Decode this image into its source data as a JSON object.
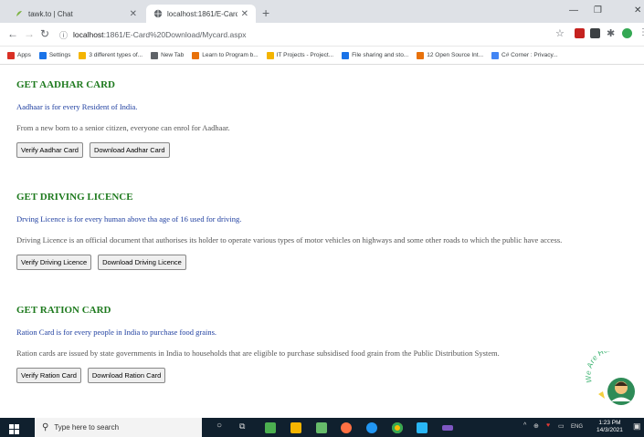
{
  "browser": {
    "tabs": [
      {
        "title": "tawk.to | Chat",
        "active": false
      },
      {
        "title": "localhost:1861/E-Card Downloa",
        "active": true
      }
    ],
    "address": {
      "host": "localhost",
      "path": ":1861/E-Card%20Download/Mycard.aspx"
    },
    "bookmarks": [
      {
        "label": "Apps",
        "icon": "apps-grid-icon",
        "color": "#d93025"
      },
      {
        "label": "Settings",
        "icon": "gear-icon",
        "color": "#1a73e8"
      },
      {
        "label": "3 different types of...",
        "icon": "bookmark-icon",
        "color": "#f4b400"
      },
      {
        "label": "New Tab",
        "icon": "globe-icon",
        "color": "#5f6368"
      },
      {
        "label": "Learn to Program b...",
        "icon": "code-icon",
        "color": "#e8710a"
      },
      {
        "label": "IT Projects - Project...",
        "icon": "bookmark-icon",
        "color": "#f4b400"
      },
      {
        "label": "File sharing and sto...",
        "icon": "file-icon",
        "color": "#1a73e8"
      },
      {
        "label": "12 Open Source Int...",
        "icon": "diamond-icon",
        "color": "#e8710a"
      },
      {
        "label": "C# Corner : Privacy...",
        "icon": "csharp-icon",
        "color": "#4285f4"
      }
    ]
  },
  "sections": [
    {
      "heading": "GET AADHAR CARD",
      "line1": "Aadhaar is for every Resident of India.",
      "line2": "From a new born to a senior citizen, everyone can enrol for Aadhaar.",
      "buttons": [
        "Verify Aadhar Card",
        "Download Aadhar Card"
      ]
    },
    {
      "heading": "GET DRIVING LICENCE",
      "line1": "Drving Licence is for every human above tha age of 16 used for driving.",
      "line2": "Driving Licence is an official document that authorises its holder to operate various types of motor vehicles on highways and some other roads to which the public have access.",
      "buttons": [
        "Verify Driving Licence",
        "Download Driving Licence"
      ]
    },
    {
      "heading": "GET RATION CARD",
      "line1": "Ration Card is for every people in India to purchase food grains.",
      "line2": "Ration cards are issued by state governments in India to households that are eligible to purchase subsidised food grain from the Public Distribution System.",
      "buttons": [
        "Verify Ration Card",
        "Download Ration Card"
      ]
    }
  ],
  "chat_widget": {
    "text": "We Are Here!"
  },
  "taskbar": {
    "search_placeholder": "Type here to search",
    "language": "ENG",
    "time": "1:23 PM",
    "date": "14/3/2021"
  }
}
